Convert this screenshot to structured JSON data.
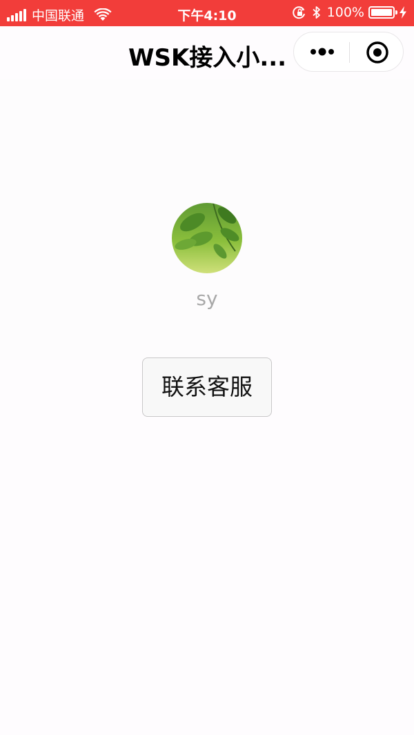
{
  "status_bar": {
    "carrier": "中国联通",
    "time": "下午4:10",
    "battery_percent": "100%",
    "background_color": "#f23d3a",
    "icons": [
      "signal-icon",
      "wifi-icon",
      "orientation-lock-icon",
      "bluetooth-icon",
      "battery-icon",
      "charging-icon"
    ]
  },
  "nav": {
    "title": "WSK接入小...",
    "capsule_icons": [
      "more-icon",
      "close-icon"
    ]
  },
  "profile": {
    "nickname": "sy",
    "avatar_icon": "leaf-avatar"
  },
  "actions": {
    "contact_label": "联系客服"
  }
}
